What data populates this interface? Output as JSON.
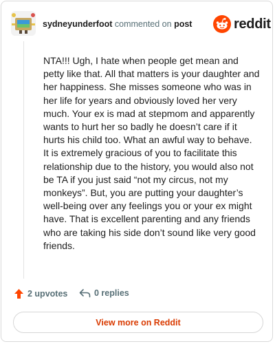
{
  "header": {
    "username": "sydneyunderfoot",
    "action_text": "commented on",
    "post_link": "post",
    "brand": "reddit"
  },
  "comment": {
    "body": "NTA!!! Ugh, I hate when people get mean and petty like that. All that matters is your daughter and her happiness. She misses someone who was in her life for years and obviously loved her very much. Your ex is mad at stepmom and apparently wants to hurt her so badly he doesn’t care if it hurts his child too. What an awful way to behave. It is extremely gracious of you to facilitate this relationship due to the history, you would also not be TA if you just said “not my circus, not my monkeys”. But, you are putting your daughter’s well-being over any feelings you or your ex might have. That is excellent parenting and any friends who are taking his side don’t sound like very good friends."
  },
  "actions": {
    "upvotes": "2 upvotes",
    "replies": "0 replies"
  },
  "footer": {
    "view_more": "View more on Reddit"
  },
  "colors": {
    "accent": "#ff4500",
    "link": "#d93a00",
    "muted_text": "#576f76"
  },
  "icons": {
    "upvote": "arrow-up-icon",
    "reply": "reply-arrow-icon",
    "logo": "reddit-snoo-icon"
  }
}
